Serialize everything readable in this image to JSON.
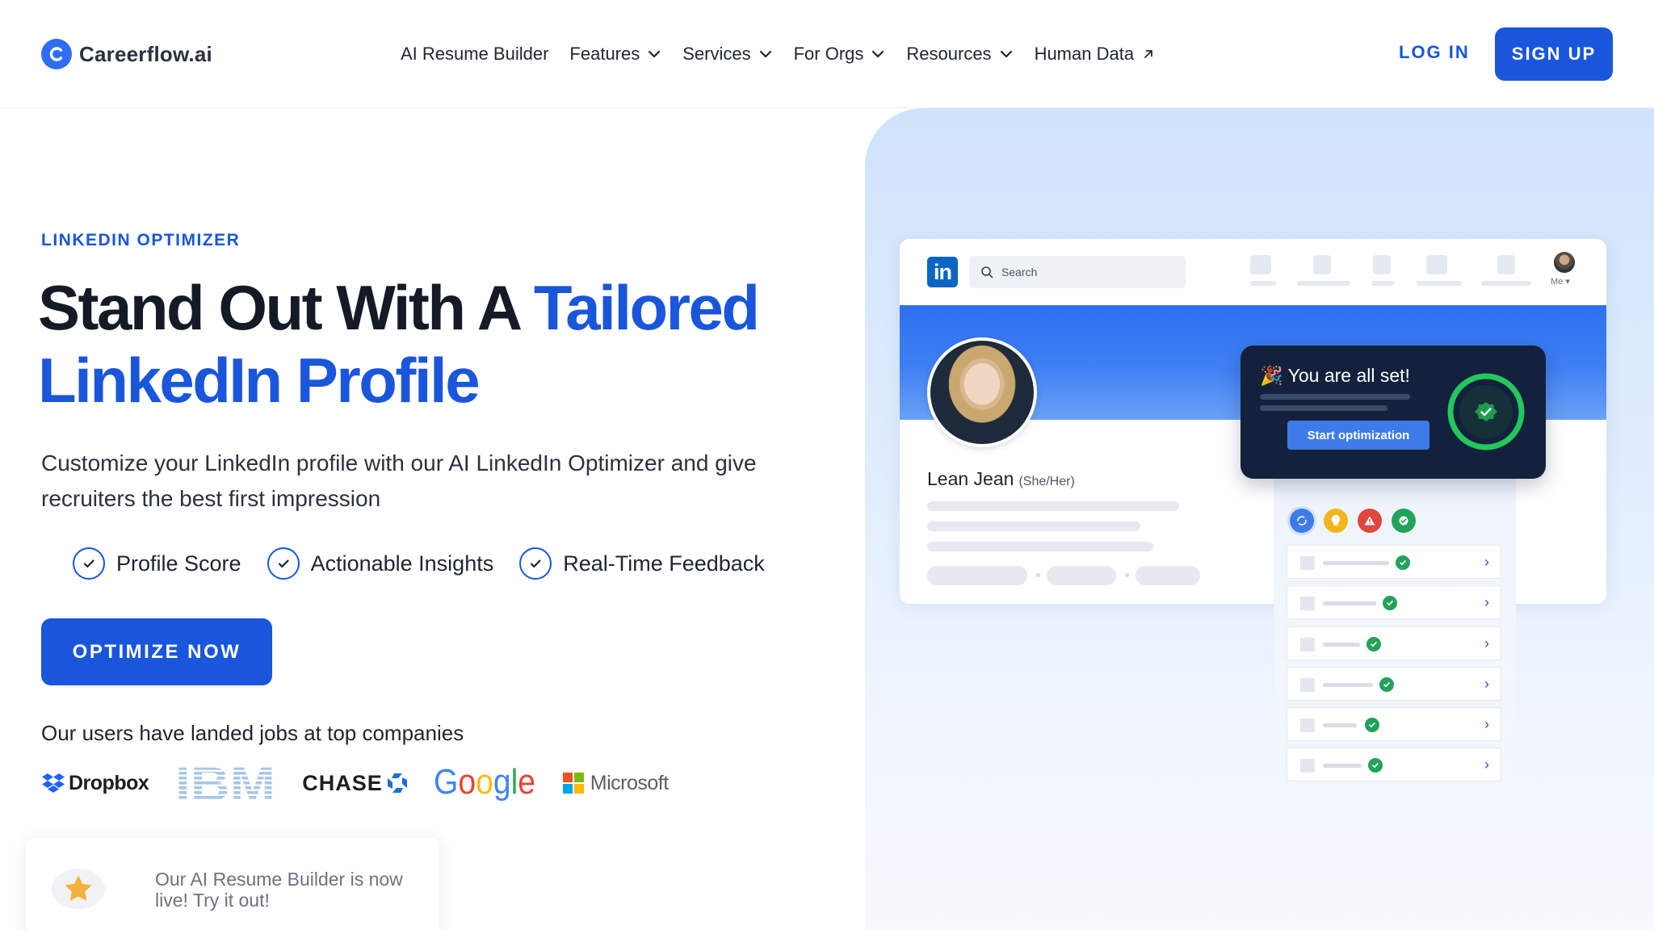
{
  "nav": {
    "brand": "Careerflow.ai",
    "menu": [
      {
        "label": "AI Resume Builder",
        "dropdown": false
      },
      {
        "label": "Features",
        "dropdown": true
      },
      {
        "label": "Services",
        "dropdown": true
      },
      {
        "label": "For Orgs",
        "dropdown": true
      },
      {
        "label": "Resources",
        "dropdown": true
      },
      {
        "label": "Human Data",
        "external": true
      }
    ],
    "login": "LOG IN",
    "signup": "SIGN UP"
  },
  "hero": {
    "eyebrow": "LINKEDIN OPTIMIZER",
    "headline_a": "Stand Out With A ",
    "headline_b": "Tailored",
    "headline_c": "LinkedIn Profile",
    "subtitle": "Customize your LinkedIn profile with our AI LinkedIn Optimizer and give recruiters the best first impression",
    "features": [
      "Profile Score",
      "Actionable Insights",
      "Real-Time Feedback"
    ],
    "cta": "OPTIMIZE NOW",
    "landed": "Our users have landed jobs at top companies",
    "companies": [
      "Dropbox",
      "IBM",
      "CHASE",
      "Google",
      "Microsoft"
    ]
  },
  "toast": {
    "text": "Our AI Resume Builder is now live! Try it out!"
  },
  "mock": {
    "search_placeholder": "Search",
    "me": "Me",
    "name": "Lean Jean",
    "pronoun": "(She/Her)",
    "card_title": "You are all set!",
    "card_emoji": "🎉",
    "card_button": "Start optimization"
  },
  "colors": {
    "brand": "#1a56db",
    "dark_card": "#14213d",
    "success": "#22a35a",
    "linkedin": "#0a66c2"
  }
}
